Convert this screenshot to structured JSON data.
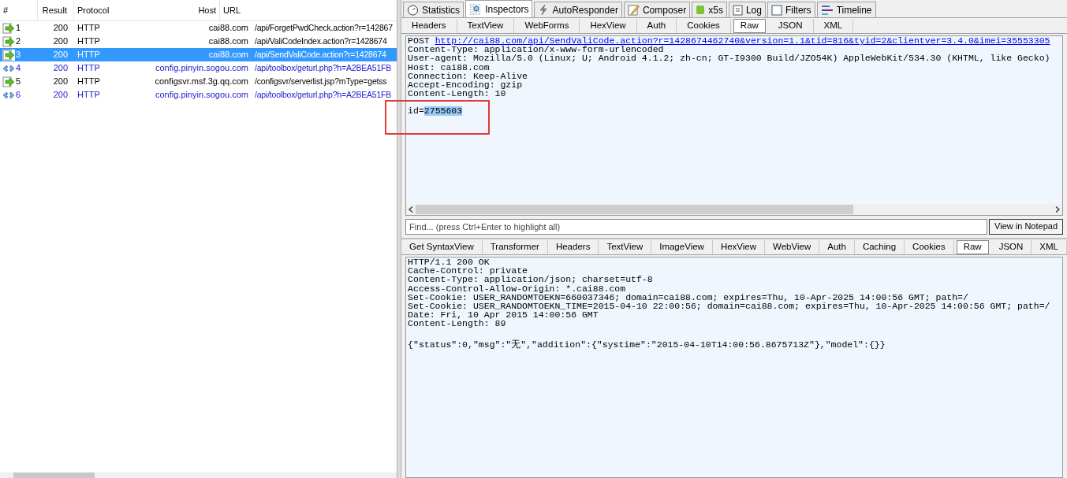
{
  "sessions": {
    "columns": [
      "#",
      "Result",
      "Protocol",
      "Host",
      "URL"
    ],
    "rows": [
      {
        "kind": "post",
        "id": "1",
        "result": "200",
        "protocol": "HTTP",
        "host": "cai88.com",
        "url": "/api/ForgetPwdCheck.action?r=142867",
        "selected": false
      },
      {
        "kind": "post",
        "id": "2",
        "result": "200",
        "protocol": "HTTP",
        "host": "cai88.com",
        "url": "/api/ValiCodeIndex.action?r=1428674",
        "selected": false
      },
      {
        "kind": "post",
        "id": "3",
        "result": "200",
        "protocol": "HTTP",
        "host": "cai88.com",
        "url": "/api/SendValiCode.action?r=1428674",
        "selected": true
      },
      {
        "kind": "get",
        "id": "4",
        "result": "200",
        "protocol": "HTTP",
        "host": "config.pinyin.sogou.com",
        "url": "/api/toolbox/geturl.php?h=A2BEA51FB",
        "selected": false
      },
      {
        "kind": "post",
        "id": "5",
        "result": "200",
        "protocol": "HTTP",
        "host": "configsvr.msf.3g.qq.com",
        "url": "/configsvr/serverlist.jsp?mType=getss",
        "selected": false
      },
      {
        "kind": "get",
        "id": "6",
        "result": "200",
        "protocol": "HTTP",
        "host": "config.pinyin.sogou.com",
        "url": "/api/toolbox/geturl.php?h=A2BEA51FB",
        "selected": false
      }
    ]
  },
  "main_tabs": [
    {
      "kind": "statistics",
      "label": "Statistics",
      "selected": false
    },
    {
      "kind": "inspectors",
      "label": "Inspectors",
      "selected": true
    },
    {
      "kind": "autoresponder",
      "label": "AutoResponder",
      "selected": false
    },
    {
      "kind": "composer",
      "label": "Composer",
      "selected": false
    },
    {
      "kind": "x5s",
      "label": "x5s",
      "selected": false
    },
    {
      "kind": "log",
      "label": "Log",
      "selected": false
    },
    {
      "kind": "filters",
      "label": "Filters",
      "selected": false
    },
    {
      "kind": "timeline",
      "label": "Timeline",
      "selected": false
    }
  ],
  "request": {
    "tabs": [
      {
        "label": "Headers",
        "selected": false
      },
      {
        "label": "TextView",
        "selected": false
      },
      {
        "label": "WebForms",
        "selected": false
      },
      {
        "label": "HexView",
        "selected": false
      },
      {
        "label": "Auth",
        "selected": false
      },
      {
        "label": "Cookies",
        "selected": false
      },
      {
        "label": "Raw",
        "selected": true
      },
      {
        "label": "JSON",
        "selected": false
      },
      {
        "label": "XML",
        "selected": false
      }
    ],
    "method": "POST",
    "url": "http://cai88.com/api/SendValiCode.action?r=1428674462740&version=1.1&tid=816&tyid=2&clientver=3.4.0&imei=35553305",
    "headers": [
      "Content-Type: application/x-www-form-urlencoded",
      "User-agent: Mozilla/5.0 (Linux; U; Android 4.1.2; zh-cn; GT-I9300 Build/JZO54K) AppleWebKit/534.30 (KHTML, like Gecko)",
      "Host: cai88.com",
      "Connection: Keep-Alive",
      "Accept-Encoding: gzip",
      "Content-Length: 10"
    ],
    "body_prefix": "id=",
    "body_selected": "2755603",
    "find_placeholder": "Find... (press Ctrl+Enter to highlight all)",
    "notepad_button": "View in Notepad"
  },
  "response": {
    "tabs": [
      {
        "label": "Get SyntaxView",
        "selected": false
      },
      {
        "label": "Transformer",
        "selected": false
      },
      {
        "label": "Headers",
        "selected": false
      },
      {
        "label": "TextView",
        "selected": false
      },
      {
        "label": "ImageView",
        "selected": false
      },
      {
        "label": "HexView",
        "selected": false
      },
      {
        "label": "WebView",
        "selected": false
      },
      {
        "label": "Auth",
        "selected": false
      },
      {
        "label": "Caching",
        "selected": false
      },
      {
        "label": "Cookies",
        "selected": false
      },
      {
        "label": "Raw",
        "selected": true
      },
      {
        "label": "JSON",
        "selected": false
      },
      {
        "label": "XML",
        "selected": false
      }
    ],
    "lines": [
      "HTTP/1.1 200 OK",
      "Cache-Control: private",
      "Content-Type: application/json; charset=utf-8",
      "Access-Control-Allow-Origin: *.cai88.com",
      "Set-Cookie: USER_RANDOMTOEKN=660037346; domain=cai88.com; expires=Thu, 10-Apr-2025 14:00:56 GMT; path=/",
      "Set-Cookie: USER_RANDOMTOEKN_TIME=2015-04-10 22:00:56; domain=cai88.com; expires=Thu, 10-Apr-2025 14:00:56 GMT; path=/",
      "Date: Fri, 10 Apr 2015 14:00:56 GMT",
      "Content-Length: 89"
    ],
    "body": "{\"status\":0,\"msg\":\"无\",\"addition\":{\"systime\":\"2015-04-10T14:00:56.8675713Z\"},\"model\":{}}"
  }
}
